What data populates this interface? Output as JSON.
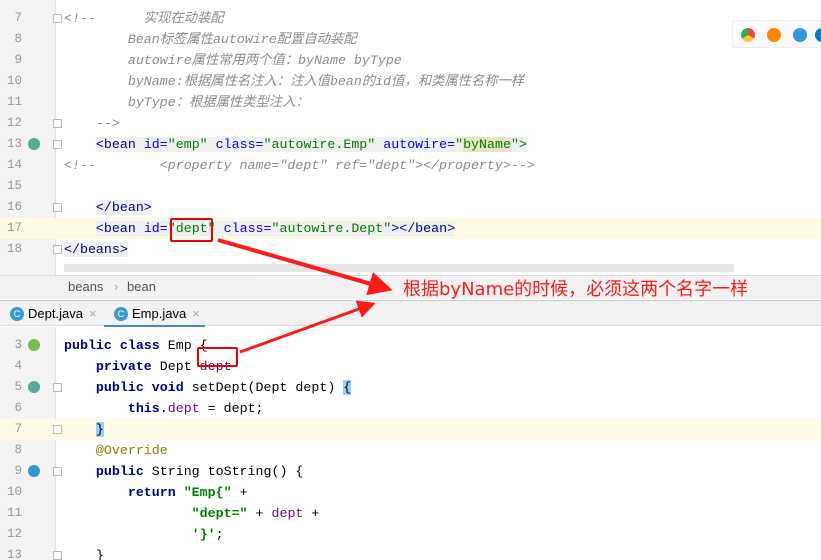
{
  "xml_editor": {
    "lines": [
      {
        "n": "7",
        "tokens": [
          [
            "<!--      ",
            "c"
          ],
          [
            "实现在动装配",
            "c"
          ]
        ]
      },
      {
        "n": "8",
        "tokens": [
          [
            "        Bean标签属性autowire配置自动装配",
            "c"
          ]
        ]
      },
      {
        "n": "9",
        "tokens": [
          [
            "        autowire属性常用两个值：byName byType",
            "c"
          ]
        ]
      },
      {
        "n": "10",
        "tokens": [
          [
            "        byName:根据属性名注入：注入值bean的id值，和类属性名称一样",
            "c"
          ]
        ]
      },
      {
        "n": "11",
        "tokens": [
          [
            "        byType：根据属性类型注入：",
            "c"
          ]
        ]
      },
      {
        "n": "12",
        "tokens": [
          [
            "    -->",
            "c"
          ]
        ]
      },
      {
        "n": "13",
        "tokens": [
          [
            "    ",
            "p"
          ],
          [
            "<bean ",
            "t"
          ],
          [
            "id=",
            "a"
          ],
          [
            "\"emp\" ",
            "s"
          ],
          [
            "class=",
            "a"
          ],
          [
            "\"autowire.Emp\" ",
            "s"
          ],
          [
            "autowire=",
            "a"
          ],
          [
            "\"",
            "s"
          ],
          [
            "byName",
            "sb"
          ],
          [
            "\">",
            "s"
          ]
        ]
      },
      {
        "n": "14",
        "tokens": [
          [
            "<!--        <property name=\"dept\" ref=\"dept\"></property>-->",
            "c"
          ]
        ]
      },
      {
        "n": "15",
        "tokens": []
      },
      {
        "n": "16",
        "tokens": [
          [
            "    ",
            "p"
          ],
          [
            "</bean>",
            "t"
          ]
        ]
      },
      {
        "n": "17",
        "tokens": [
          [
            "    ",
            "p"
          ],
          [
            "<bean ",
            "t"
          ],
          [
            "id=",
            "a"
          ],
          [
            "\"dept\"",
            "s"
          ],
          [
            " ",
            "t"
          ],
          [
            "class=",
            "a"
          ],
          [
            "\"autowire.Dept\"",
            "s"
          ],
          [
            "></bean>",
            "t"
          ]
        ]
      },
      {
        "n": "18",
        "tokens": [
          [
            "</beans>",
            "t"
          ]
        ]
      }
    ]
  },
  "breadcrumb": [
    "beans",
    "bean"
  ],
  "tabs": [
    {
      "label": "Dept.java",
      "icon": "C",
      "active": false
    },
    {
      "label": "Emp.java",
      "icon": "C",
      "active": true
    }
  ],
  "java_editor": {
    "lines": [
      {
        "n": "3",
        "tokens": [
          [
            "public class ",
            "k"
          ],
          [
            "Emp {",
            "p"
          ]
        ]
      },
      {
        "n": "4",
        "tokens": [
          [
            "    ",
            "p"
          ],
          [
            "private ",
            "k"
          ],
          [
            "Dept ",
            "p"
          ],
          [
            "dept",
            "f"
          ]
        ]
      },
      {
        "n": "5",
        "tokens": [
          [
            "    ",
            "p"
          ],
          [
            "public void ",
            "k"
          ],
          [
            "setDept(Dept dept) ",
            "p"
          ],
          [
            "{",
            "brk"
          ]
        ]
      },
      {
        "n": "6",
        "tokens": [
          [
            "        ",
            "p"
          ],
          [
            "this",
            "k"
          ],
          [
            ".",
            "p"
          ],
          [
            "dept",
            "f"
          ],
          [
            " = dept;",
            "p"
          ]
        ]
      },
      {
        "n": "7",
        "tokens": [
          [
            "    ",
            "p"
          ],
          [
            "}",
            "brk"
          ]
        ]
      },
      {
        "n": "8",
        "tokens": [
          [
            "    ",
            "p"
          ],
          [
            "@Override",
            "an"
          ]
        ]
      },
      {
        "n": "9",
        "tokens": [
          [
            "    ",
            "p"
          ],
          [
            "public ",
            "k"
          ],
          [
            "String toString() {",
            "p"
          ]
        ]
      },
      {
        "n": "10",
        "tokens": [
          [
            "        ",
            "p"
          ],
          [
            "return ",
            "k"
          ],
          [
            "\"Emp{\"",
            "js"
          ],
          [
            " +",
            "p"
          ]
        ]
      },
      {
        "n": "11",
        "tokens": [
          [
            "                ",
            "p"
          ],
          [
            "\"dept=\"",
            "js"
          ],
          [
            " + ",
            "p"
          ],
          [
            "dept",
            "f"
          ],
          [
            " +",
            "p"
          ]
        ]
      },
      {
        "n": "12",
        "tokens": [
          [
            "                ",
            "p"
          ],
          [
            "'}'",
            "js"
          ],
          [
            ";",
            "p"
          ]
        ]
      },
      {
        "n": "13",
        "tokens": [
          [
            "    }",
            "p"
          ]
        ]
      }
    ]
  },
  "annotation": {
    "text": "根据byName的时候，必须这两个名字一样",
    "color": "#ff1a1a"
  }
}
